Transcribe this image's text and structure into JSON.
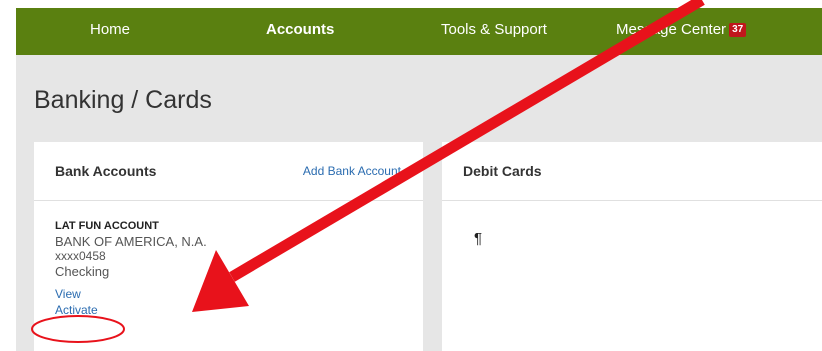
{
  "nav": {
    "items": [
      {
        "label": "Home",
        "active": false
      },
      {
        "label": "Accounts",
        "active": true
      },
      {
        "label": "Tools & Support",
        "active": false
      },
      {
        "label": "Message Center",
        "active": false,
        "badge": "37"
      }
    ],
    "bar_color": "#5a8010",
    "badge_color": "#c0161c"
  },
  "page": {
    "title": "Banking / Cards"
  },
  "bank_accounts": {
    "title": "Bank Accounts",
    "add_link": "Add Bank Account",
    "account": {
      "name": "LAT FUN ACCOUNT",
      "bank": "BANK OF AMERICA, N.A.",
      "number": "xxxx0458",
      "type": "Checking",
      "view_link": "View",
      "activate_link": "Activate"
    }
  },
  "debit_cards": {
    "title": "Debit Cards",
    "placeholder_mark": "¶"
  },
  "annotation": {
    "color": "#e8121b",
    "shape": "arrow-icon",
    "highlight": "ellipse-highlight"
  }
}
